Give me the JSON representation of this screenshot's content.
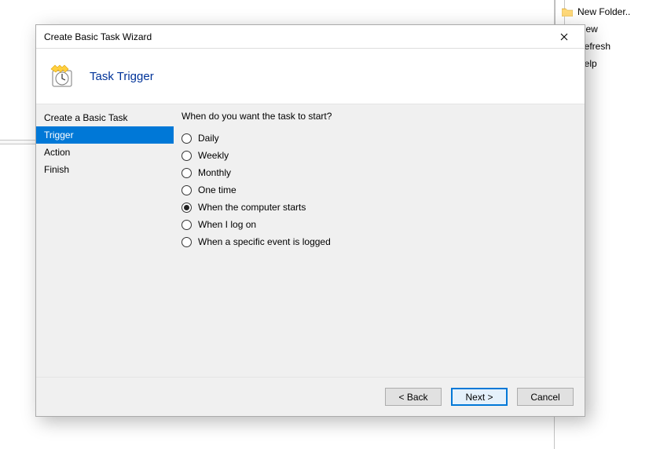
{
  "window": {
    "title": "Create Basic Task Wizard",
    "header": "Task Trigger"
  },
  "steps": [
    {
      "label": "Create a Basic Task",
      "selected": false
    },
    {
      "label": "Trigger",
      "selected": true
    },
    {
      "label": "Action",
      "selected": false
    },
    {
      "label": "Finish",
      "selected": false
    }
  ],
  "content": {
    "question": "When do you want the task to start?",
    "options": [
      {
        "label": "Daily",
        "checked": false
      },
      {
        "label": "Weekly",
        "checked": false
      },
      {
        "label": "Monthly",
        "checked": false
      },
      {
        "label": "One time",
        "checked": false
      },
      {
        "label": "When the computer starts",
        "checked": true
      },
      {
        "label": "When I log on",
        "checked": false
      },
      {
        "label": "When a specific event is logged",
        "checked": false
      }
    ]
  },
  "buttons": {
    "back": "< Back",
    "next": "Next >",
    "cancel": "Cancel"
  },
  "background_panel": {
    "items": [
      {
        "label": "New Folder..",
        "icon": "folder-icon"
      },
      {
        "label": "View",
        "icon": null
      },
      {
        "label": "Refresh",
        "icon": null
      },
      {
        "label": "Help",
        "icon": null
      }
    ]
  }
}
